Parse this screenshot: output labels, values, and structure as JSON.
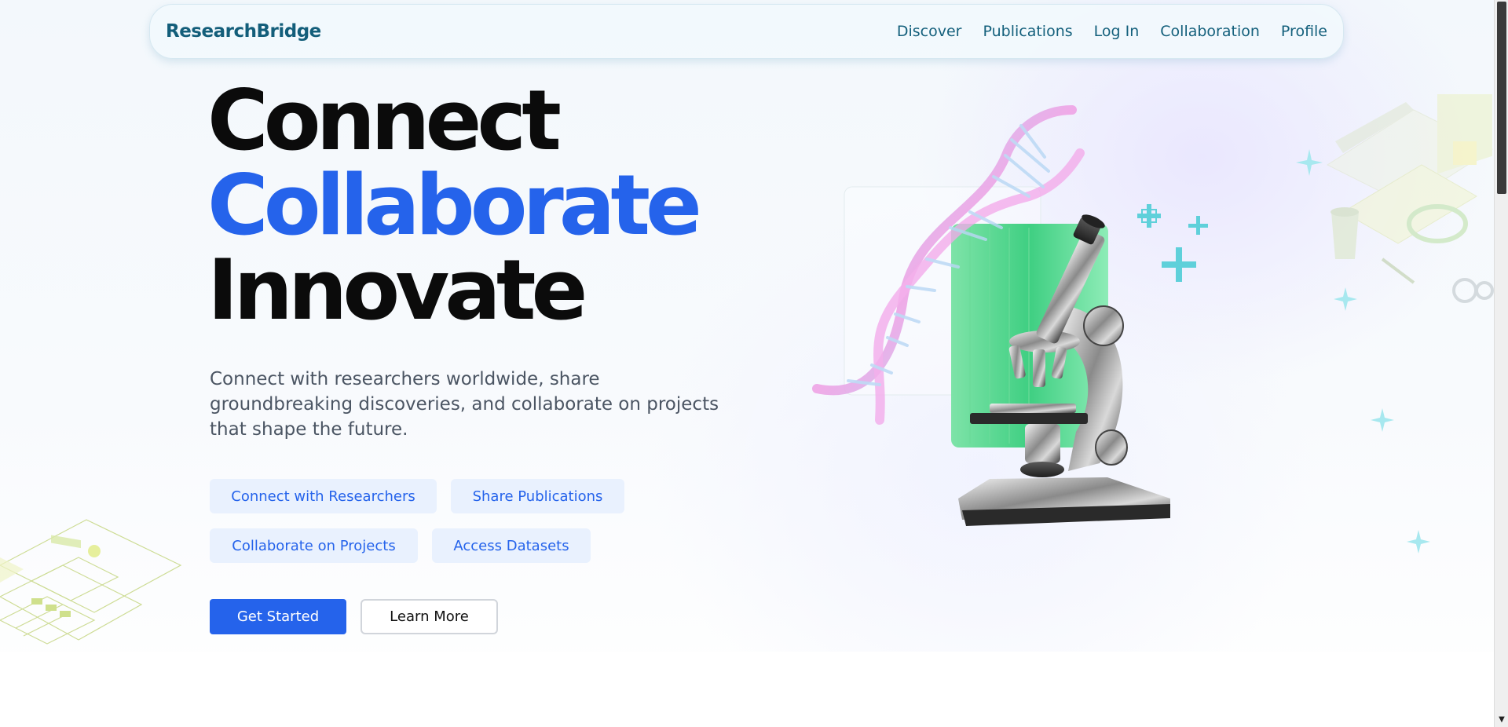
{
  "brand": {
    "name": "ResearchBridge",
    "color": "#135e7a"
  },
  "nav": {
    "links": [
      "Discover",
      "Publications",
      "Log In",
      "Collaboration",
      "Profile"
    ]
  },
  "hero": {
    "headline": [
      "Connect",
      "Collaborate",
      "Innovate"
    ],
    "accent_color": "#2563eb",
    "description": "Connect with researchers worldwide, share groundbreaking discoveries, and collaborate on projects that shape the future.",
    "features": [
      "Connect with Researchers",
      "Share Publications",
      "Collaborate on Projects",
      "Access Datasets"
    ],
    "primary_cta": "Get Started",
    "secondary_cta": "Learn More"
  },
  "illustration": {
    "icons": [
      "dna-helix-icon",
      "microscope-icon",
      "sparkle-icon",
      "lab-desk-icon"
    ],
    "colors": {
      "dna_pink": "#f0a3e6",
      "dna_cyan": "#9fe3f2",
      "panel_green": "#4fd08a",
      "sparkle": "#5fd0da"
    }
  }
}
